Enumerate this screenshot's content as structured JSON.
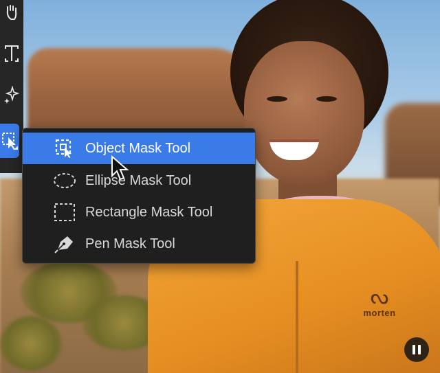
{
  "colors": {
    "accent": "#3b7be8",
    "menu_bg": "#1f1f1f",
    "toolbar_bg": "#262626",
    "jacket": "#e68f22"
  },
  "toolbar": {
    "tools": [
      {
        "icon": "hand-icon"
      },
      {
        "icon": "type-tool-icon"
      },
      {
        "icon": "sparkle-effects-icon"
      },
      {
        "icon": "mask-tool-icon",
        "active": true
      }
    ]
  },
  "menu": {
    "items": [
      {
        "label": "Object Mask Tool",
        "icon": "object-mask-icon",
        "selected": true
      },
      {
        "label": "Ellipse Mask Tool",
        "icon": "ellipse-mask-icon"
      },
      {
        "label": "Rectangle Mask Tool",
        "icon": "rectangle-mask-icon"
      },
      {
        "label": "Pen Mask Tool",
        "icon": "pen-mask-icon"
      }
    ]
  },
  "photo": {
    "brand_name": "morten"
  },
  "playback": {
    "state_icon": "pause-icon"
  }
}
